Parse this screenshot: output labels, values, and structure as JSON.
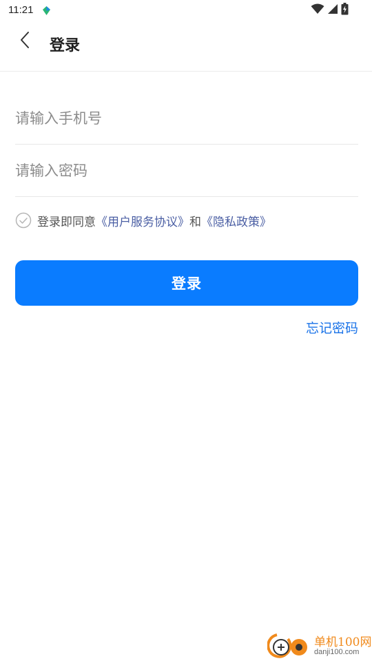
{
  "status_bar": {
    "time": "11:21",
    "app_icon": "app-notification-icon",
    "signal_icons": [
      "wifi-icon",
      "cellular-signal-icon",
      "battery-charging-icon"
    ]
  },
  "header": {
    "back_icon": "chevron-left-icon",
    "title": "登录"
  },
  "form": {
    "phone_placeholder": "请输入手机号",
    "phone_value": "",
    "password_placeholder": "请输入密码",
    "password_value": ""
  },
  "agreement": {
    "checked": false,
    "prefix": "登录即同意",
    "user_agreement": "《用户服务协议》",
    "conjunction": "和",
    "privacy_policy": "《隐私政策》"
  },
  "actions": {
    "login_label": "登录",
    "forgot_password": "忘记密码"
  },
  "watermark": {
    "name": "单机100网",
    "url": "danji100.com"
  },
  "colors": {
    "primary": "#0a7cff",
    "link": "#4a5ea3",
    "forgot_link": "#1a73e8",
    "watermark_orange": "#f08a1c"
  }
}
